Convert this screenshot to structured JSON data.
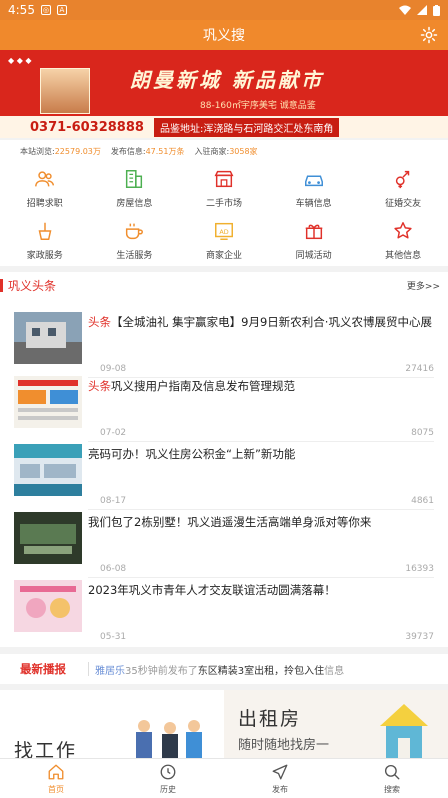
{
  "statusbar": {
    "time": "4:55",
    "box1": "◎",
    "box2": "A"
  },
  "app": {
    "title": "巩义搜",
    "accent": "#f0892c"
  },
  "banner": {
    "title": "朗曼新城 新品献市",
    "subtitle": "88-160㎡宇序美宅 诚意品鉴",
    "phone": "0371-60328888",
    "address": "品鉴地址:浑浇路与石河路交汇处东南角"
  },
  "stats": {
    "visits_label": "本站浏览:",
    "visits": "22579.03万",
    "posts_label": "发布信息:",
    "posts": "47.51万条",
    "merchants_label": "入驻商家:",
    "merchants": "3058家"
  },
  "categories": [
    {
      "label": "招聘求职",
      "icon": "people-icon",
      "color": "#f08e2e"
    },
    {
      "label": "房屋信息",
      "icon": "building-icon",
      "color": "#4caf50"
    },
    {
      "label": "二手市场",
      "icon": "shop-icon",
      "color": "#e0312a"
    },
    {
      "label": "车辆信息",
      "icon": "car-icon",
      "color": "#3f8fd6"
    },
    {
      "label": "征婚交友",
      "icon": "gender-icon",
      "color": "#e0312a"
    },
    {
      "label": "家政服务",
      "icon": "broom-icon",
      "color": "#f08e2e"
    },
    {
      "label": "生活服务",
      "icon": "cup-icon",
      "color": "#f08e2e"
    },
    {
      "label": "商家企业",
      "icon": "ad-icon",
      "color": "#f0b02e"
    },
    {
      "label": "同城活动",
      "icon": "gift-icon",
      "color": "#e0312a"
    },
    {
      "label": "其他信息",
      "icon": "star-icon",
      "color": "#e0312a"
    }
  ],
  "headlines": {
    "title": "巩义头条",
    "more": "更多>>",
    "items": [
      {
        "tag": "头条",
        "title": "【全城油礼 集宇赢家电】9月9日新农利合·巩义农博展贸中心展",
        "date": "09-08",
        "views": "27416"
      },
      {
        "tag": "头条",
        "title": "巩义搜用户指南及信息发布管理规范",
        "date": "07-02",
        "views": "8075"
      },
      {
        "tag": "",
        "title": "亮码可办！巩义住房公积金“上新”新功能",
        "date": "08-17",
        "views": "4861"
      },
      {
        "tag": "",
        "title": "我们包了2栋别墅！巩义逍遥漫生活高端单身派对等你来",
        "date": "06-08",
        "views": "16393"
      },
      {
        "tag": "",
        "title": "2023年巩义市青年人才交友联谊活动圆满落幕！",
        "date": "05-31",
        "views": "39737"
      }
    ]
  },
  "ticker": {
    "label": "最新播报",
    "user": "雅居乐",
    "time": "35秒钟前发布了",
    "text": "东区精装3室出租，拎包入住",
    "tail": "信息"
  },
  "promo": {
    "job": "找工作",
    "rent": "出租房",
    "rent_sub": "随时随地找房一"
  },
  "tabs": [
    {
      "label": "首页",
      "icon": "home-icon"
    },
    {
      "label": "历史",
      "icon": "clock-icon"
    },
    {
      "label": "发布",
      "icon": "send-icon"
    },
    {
      "label": "搜索",
      "icon": "search-icon"
    }
  ]
}
